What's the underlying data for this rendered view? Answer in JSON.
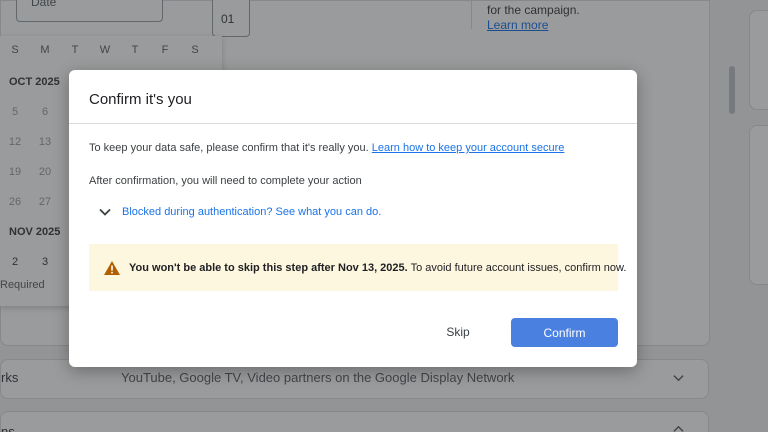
{
  "background": {
    "date_label": "Date",
    "number_field_value": "01",
    "right_text": "for the campaign.",
    "learn_more": "Learn more",
    "weekdays": [
      "S",
      "M",
      "T",
      "W",
      "T",
      "F",
      "S"
    ],
    "month_oct": "OCT 2025",
    "oct_rows": [
      [
        "5",
        "6"
      ],
      [
        "12",
        "13"
      ],
      [
        "19",
        "20"
      ],
      [
        "26",
        "27"
      ]
    ],
    "month_nov": "NOV 2025",
    "nov_row": [
      "2",
      "3"
    ],
    "required": "Required",
    "networks_title": "rks",
    "networks_desc": "YouTube, Google TV, Video partners on the Google Display Network",
    "bottom_title": "ns"
  },
  "dialog": {
    "title": "Confirm it's you",
    "intro": "To keep your data safe, please confirm that it's really you.",
    "intro_link": "Learn how to keep your account secure",
    "after": "After confirmation, you will need to complete your action",
    "expander": "Blocked during authentication? See what you can do.",
    "warning_bold": "You won't be able to skip this step after Nov 13, 2025.",
    "warning_rest": "To avoid future account issues, confirm now.",
    "skip_label": "Skip",
    "confirm_label": "Confirm"
  },
  "colors": {
    "accent": "#4a80e0",
    "link": "#1a73e8",
    "warning_bg": "#fef7e0",
    "warning_icon": "#b06000"
  },
  "icons": {
    "expander": "chevron-down-icon",
    "warning": "warning-icon"
  }
}
